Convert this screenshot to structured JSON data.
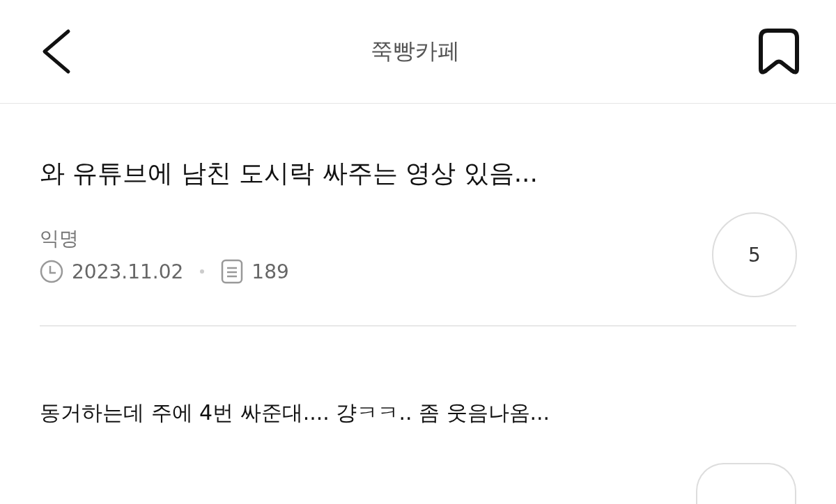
{
  "header": {
    "title": "쭉빵카페",
    "bookmarked": false
  },
  "post": {
    "title": "와 유튜브에 남친 도시락 싸주는 영상 있음...",
    "author": "익명",
    "date": "2023.11.02",
    "views": "189",
    "comments": "5",
    "body": "동거하는데 주에 4번 싸준대.... 걍ㅋㅋ.. 좀 웃음나옴..."
  }
}
